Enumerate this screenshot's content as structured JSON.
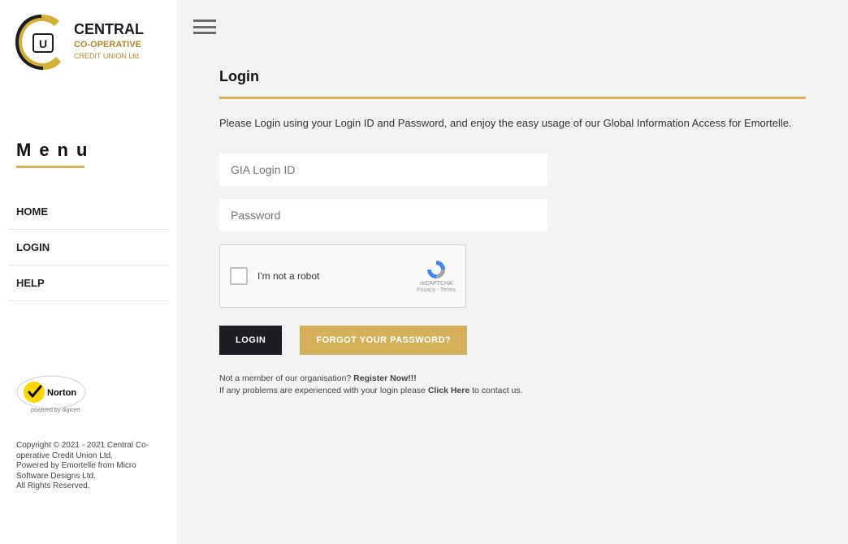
{
  "brand": {
    "name_top": "CENTRAL",
    "name_mid": "CO-OPERATIVE",
    "name_bottom": "CREDIT UNION Ltd."
  },
  "sidebar": {
    "menu_heading": "Menu",
    "items": [
      {
        "label": "HOME"
      },
      {
        "label": "LOGIN"
      },
      {
        "label": "HELP"
      }
    ],
    "norton": {
      "label": "Norton",
      "powered_by": "powered by digicert"
    },
    "footer": {
      "line1": "Copyright © 2021 - 2021 Central Co-operative Credit Union Ltd.",
      "line2": "Powered by Emortelle from Micro Software Designs Ltd.",
      "line3": "All Rights Reserved."
    }
  },
  "page": {
    "title": "Login",
    "intro": "Please Login using your Login ID and Password, and enjoy the easy usage of our Global Information Access for Emortelle.",
    "login_id_placeholder": "GIA Login ID",
    "password_placeholder": "Password",
    "recaptcha": {
      "label": "I'm not a robot",
      "brand": "reCAPTCHA",
      "sublinks": "Privacy - Terms"
    },
    "login_btn": "LOGIN",
    "forgot_btn": "FORGOT YOUR PASSWORD?",
    "register_prefix": "Not a member of our organisation? ",
    "register_link": "Register Now!!!",
    "help_prefix": "If any problems are experienced with your login please ",
    "help_link": "Click Here",
    "help_suffix": " to contact us."
  }
}
